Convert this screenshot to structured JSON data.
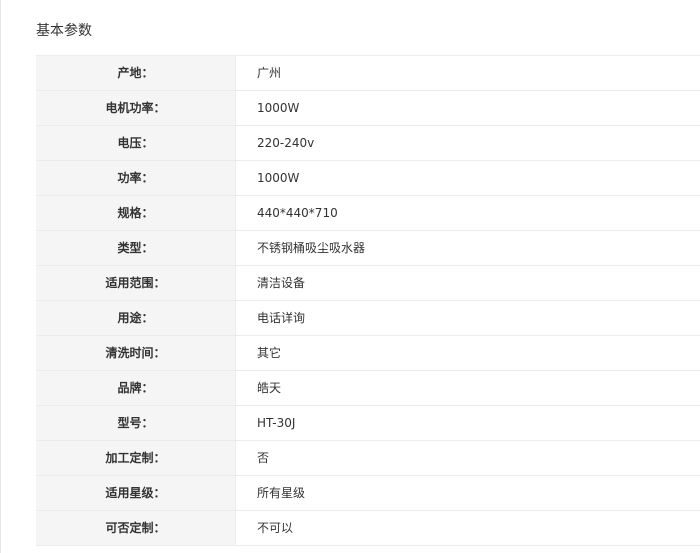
{
  "section": {
    "title": "基本参数"
  },
  "params": [
    {
      "label": "产地：",
      "value": "广州"
    },
    {
      "label": "电机功率：",
      "value": "1000W"
    },
    {
      "label": "电压：",
      "value": "220-240v"
    },
    {
      "label": "功率：",
      "value": "1000W"
    },
    {
      "label": "规格：",
      "value": "440*440*710"
    },
    {
      "label": "类型：",
      "value": "不锈钢桶吸尘吸水器"
    },
    {
      "label": "适用范围：",
      "value": "清洁设备"
    },
    {
      "label": "用途：",
      "value": "电话详询"
    },
    {
      "label": "清洗时间：",
      "value": "其它"
    },
    {
      "label": "品牌：",
      "value": "皓天"
    },
    {
      "label": "型号：",
      "value": "HT-30J"
    },
    {
      "label": "加工定制：",
      "value": "否"
    },
    {
      "label": "适用星级：",
      "value": "所有星级"
    },
    {
      "label": "可否定制：",
      "value": "不可以"
    }
  ],
  "colors": {
    "label_background": "#f5f5f5",
    "border": "#ececec",
    "text": "#333333"
  }
}
